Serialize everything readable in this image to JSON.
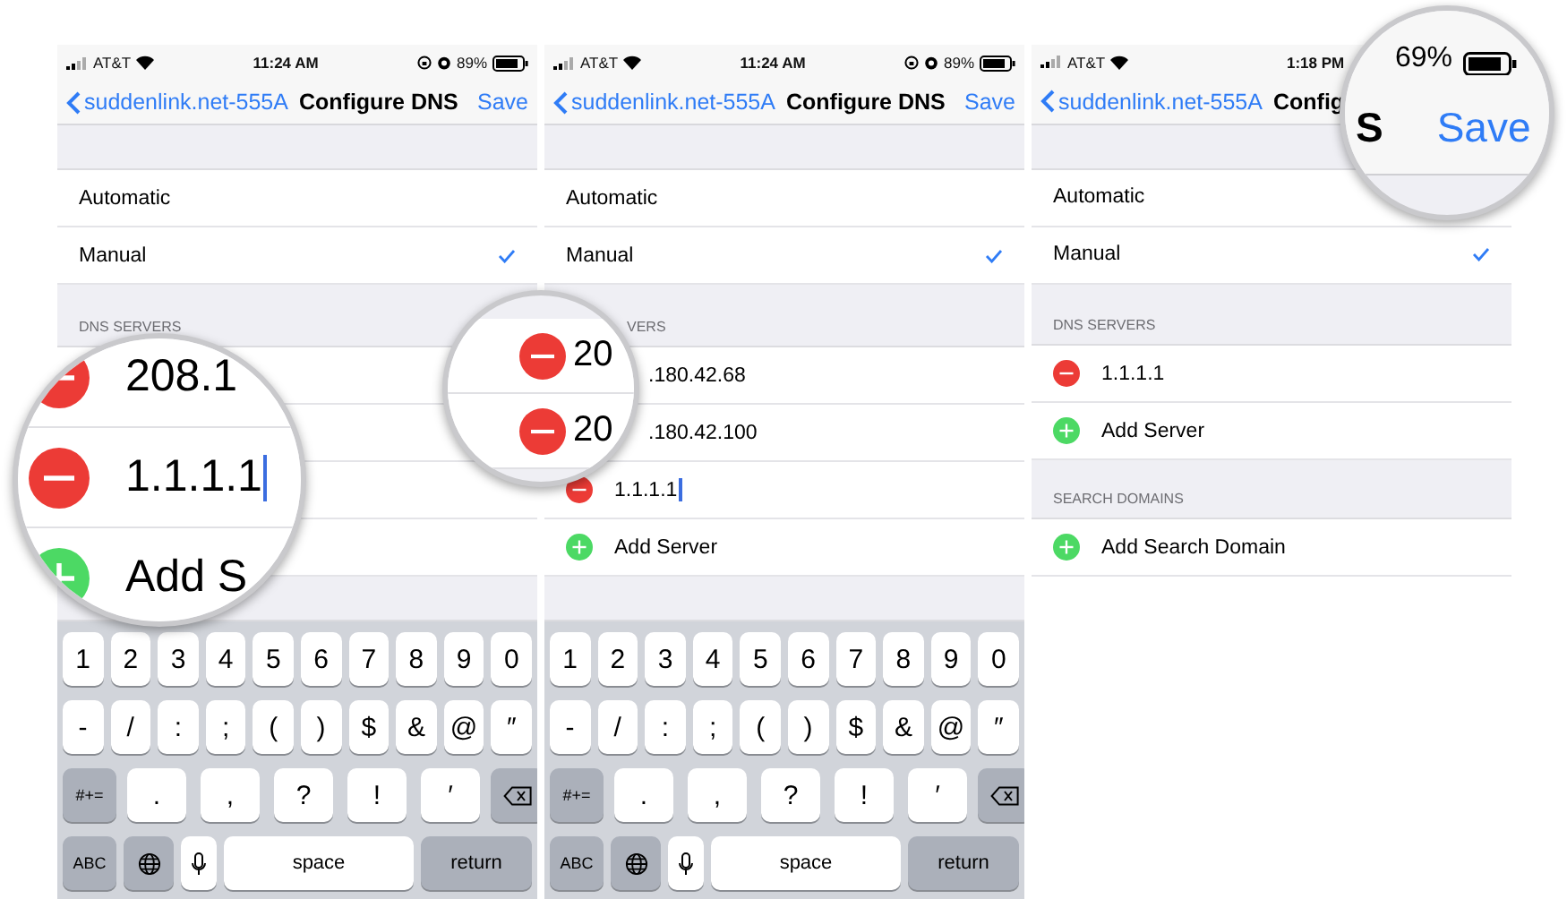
{
  "panels": [
    {
      "status": {
        "carrier": "AT&T",
        "time": "11:24 AM",
        "battery": "89%"
      },
      "nav": {
        "back": "suddenlink.net-555A",
        "title": "Configure DNS",
        "action": "Save"
      },
      "modes": [
        {
          "label": "Automatic",
          "selected": false
        },
        {
          "label": "Manual",
          "selected": true
        }
      ],
      "dns_header": "DNS SERVERS",
      "servers": [
        {
          "kind": "blank"
        },
        {
          "kind": "blank"
        },
        {
          "kind": "blank"
        },
        {
          "kind": "blank"
        }
      ],
      "keyboard": {
        "rows": [
          {
            "keys": [
              {
                "kind": "char",
                "label": "1"
              },
              {
                "kind": "char",
                "label": "2"
              },
              {
                "kind": "char",
                "label": "3"
              },
              {
                "kind": "char",
                "label": "4"
              },
              {
                "kind": "char",
                "label": "5"
              },
              {
                "kind": "char",
                "label": "6"
              },
              {
                "kind": "char",
                "label": "7"
              },
              {
                "kind": "char",
                "label": "8"
              },
              {
                "kind": "char",
                "label": "9"
              },
              {
                "kind": "char",
                "label": "0"
              }
            ]
          },
          {
            "keys": [
              {
                "kind": "char",
                "label": "-"
              },
              {
                "kind": "char",
                "label": "/"
              },
              {
                "kind": "char",
                "label": ":"
              },
              {
                "kind": "char",
                "label": ";"
              },
              {
                "kind": "char",
                "label": "("
              },
              {
                "kind": "char",
                "label": ")"
              },
              {
                "kind": "char",
                "label": "$"
              },
              {
                "kind": "char",
                "label": "&"
              },
              {
                "kind": "char",
                "label": "@"
              },
              {
                "kind": "char",
                "label": "″"
              }
            ]
          },
          {
            "keys": [
              {
                "kind": "mode",
                "label": "#+="
              },
              {
                "kind": "wide",
                "label": "."
              },
              {
                "kind": "wide",
                "label": ","
              },
              {
                "kind": "wide",
                "label": "?"
              },
              {
                "kind": "wide",
                "label": "!"
              },
              {
                "kind": "wide",
                "label": "′"
              },
              {
                "kind": "delete"
              }
            ]
          },
          {
            "keys": [
              {
                "kind": "mode",
                "label": "ABC"
              },
              {
                "kind": "globe"
              },
              {
                "kind": "mic"
              },
              {
                "kind": "space",
                "label": "space"
              },
              {
                "kind": "return",
                "label": "return"
              }
            ]
          }
        ]
      },
      "magnifier": {
        "kind": "rows",
        "rows": [
          {
            "kind": "remove",
            "text": "208.1",
            "editing": false
          },
          {
            "kind": "remove",
            "text": "1.1.1.1",
            "editing": true
          },
          {
            "kind": "add",
            "text": "Add S",
            "editing": false
          }
        ]
      }
    },
    {
      "status": {
        "carrier": "AT&T",
        "time": "11:24 AM",
        "battery": "89%"
      },
      "nav": {
        "back": "suddenlink.net-555A",
        "title": "Configure DNS",
        "action": "Save"
      },
      "modes": [
        {
          "label": "Automatic",
          "selected": false
        },
        {
          "label": "Manual",
          "selected": true
        }
      ],
      "dns_header": "VERS",
      "servers": [
        {
          "kind": "plain",
          "text": ".180.42.68",
          "editing": false
        },
        {
          "kind": "plain",
          "text": ".180.42.100",
          "editing": false
        },
        {
          "kind": "remove",
          "text": "1.1.1.1",
          "editing": true
        },
        {
          "kind": "add",
          "text": "Add Server",
          "editing": false
        }
      ],
      "keyboard": {
        "rows": [
          {
            "keys": [
              {
                "kind": "char",
                "label": "1"
              },
              {
                "kind": "char",
                "label": "2"
              },
              {
                "kind": "char",
                "label": "3"
              },
              {
                "kind": "char",
                "label": "4"
              },
              {
                "kind": "char",
                "label": "5"
              },
              {
                "kind": "char",
                "label": "6"
              },
              {
                "kind": "char",
                "label": "7"
              },
              {
                "kind": "char",
                "label": "8"
              },
              {
                "kind": "char",
                "label": "9"
              },
              {
                "kind": "char",
                "label": "0"
              }
            ]
          },
          {
            "keys": [
              {
                "kind": "char",
                "label": "-"
              },
              {
                "kind": "char",
                "label": "/"
              },
              {
                "kind": "char",
                "label": ":"
              },
              {
                "kind": "char",
                "label": ";"
              },
              {
                "kind": "char",
                "label": "("
              },
              {
                "kind": "char",
                "label": ")"
              },
              {
                "kind": "char",
                "label": "$"
              },
              {
                "kind": "char",
                "label": "&"
              },
              {
                "kind": "char",
                "label": "@"
              },
              {
                "kind": "char",
                "label": "″"
              }
            ]
          },
          {
            "keys": [
              {
                "kind": "mode",
                "label": "#+="
              },
              {
                "kind": "wide",
                "label": "."
              },
              {
                "kind": "wide",
                "label": ","
              },
              {
                "kind": "wide",
                "label": "?"
              },
              {
                "kind": "wide",
                "label": "!"
              },
              {
                "kind": "wide",
                "label": "′"
              },
              {
                "kind": "delete"
              }
            ]
          },
          {
            "keys": [
              {
                "kind": "mode",
                "label": "ABC"
              },
              {
                "kind": "globe"
              },
              {
                "kind": "mic"
              },
              {
                "kind": "space",
                "label": "space"
              },
              {
                "kind": "return",
                "label": "return"
              }
            ]
          }
        ]
      },
      "magnifier": {
        "kind": "rows",
        "rows": [
          {
            "kind": "remove",
            "text": "20",
            "editing": false
          },
          {
            "kind": "remove",
            "text": "20",
            "editing": false
          }
        ]
      }
    },
    {
      "status": {
        "carrier": "AT&T",
        "time": "1:18 PM"
      },
      "nav": {
        "back": "suddenlink.net-555A",
        "title": "Config"
      },
      "modes": [
        {
          "label": "Automatic",
          "selected": false
        },
        {
          "label": "Manual",
          "selected": true
        }
      ],
      "dns_header": "DNS SERVERS",
      "servers": [
        {
          "kind": "remove",
          "text": "1.1.1.1",
          "editing": false
        },
        {
          "kind": "add",
          "text": "Add Server",
          "editing": false
        }
      ],
      "search_header": "SEARCH DOMAINS",
      "domains": [
        {
          "kind": "add",
          "text": "Add Search Domain",
          "editing": false
        }
      ],
      "magnifier": {
        "kind": "nav",
        "battery": "69%",
        "title": "S",
        "action": "Save"
      }
    }
  ]
}
